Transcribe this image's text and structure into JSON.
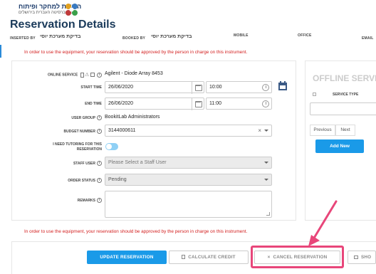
{
  "header": {
    "logo_line1": "הרשות למחקר ופיתוח",
    "logo_line2": "האוניברסיטה העברית בירושלים",
    "page_title": "Reservation Details",
    "inserted_by_label": "INSERTED BY",
    "inserted_by_value": "בדיקת מערכת יוסי",
    "booked_by_label": "BOOKED BY",
    "booked_by_value": "בדיקת מערכת יוסי",
    "mobile_label": "MOBILE",
    "office_label": "OFFICE",
    "email_label": "EMAIL"
  },
  "warning_text": "In order to use the equipment, your reservation should be approved by the person in charge on this instrument.",
  "form": {
    "online_service_label": "ONLINE SERVICE",
    "online_service_value": "Agilent - Diode Array 8453",
    "start_time_label": "START TIME",
    "start_date": "26/06/2020",
    "start_time": "10:00",
    "end_time_label": "END TIME",
    "end_date": "26/06/2020",
    "end_time": "11:00",
    "user_group_label": "USER GROUP",
    "user_group_value": "BookitLab Administrators",
    "budget_number_label": "BUDGET NUMBER",
    "budget_number_value": "3144000611",
    "tutoring_label_1": "I NEED TUTORING FOR THIS",
    "tutoring_label_2": "RESERVATION",
    "staff_user_label": "STAFF USER",
    "staff_user_placeholder": "Please Select a Staff User",
    "order_status_label": "ORDER STATUS",
    "order_status_value": "Pending",
    "remarks_label": "REMARKS"
  },
  "offline": {
    "title": "OFFLINE SERVIC",
    "service_type_label": "SERVICE TYPE",
    "previous_label": "Previous",
    "next_label": "Next",
    "add_new_label": "Add New"
  },
  "actions": {
    "update_label": "UPDATE RESERVATION",
    "calculate_label": "CALCULATE CREDIT",
    "cancel_label": "CANCEL RESERVATION",
    "show_label": "SHO"
  },
  "colors": {
    "primary": "#1a9ae8",
    "warning": "#d32020",
    "highlight": "#e8467a"
  }
}
